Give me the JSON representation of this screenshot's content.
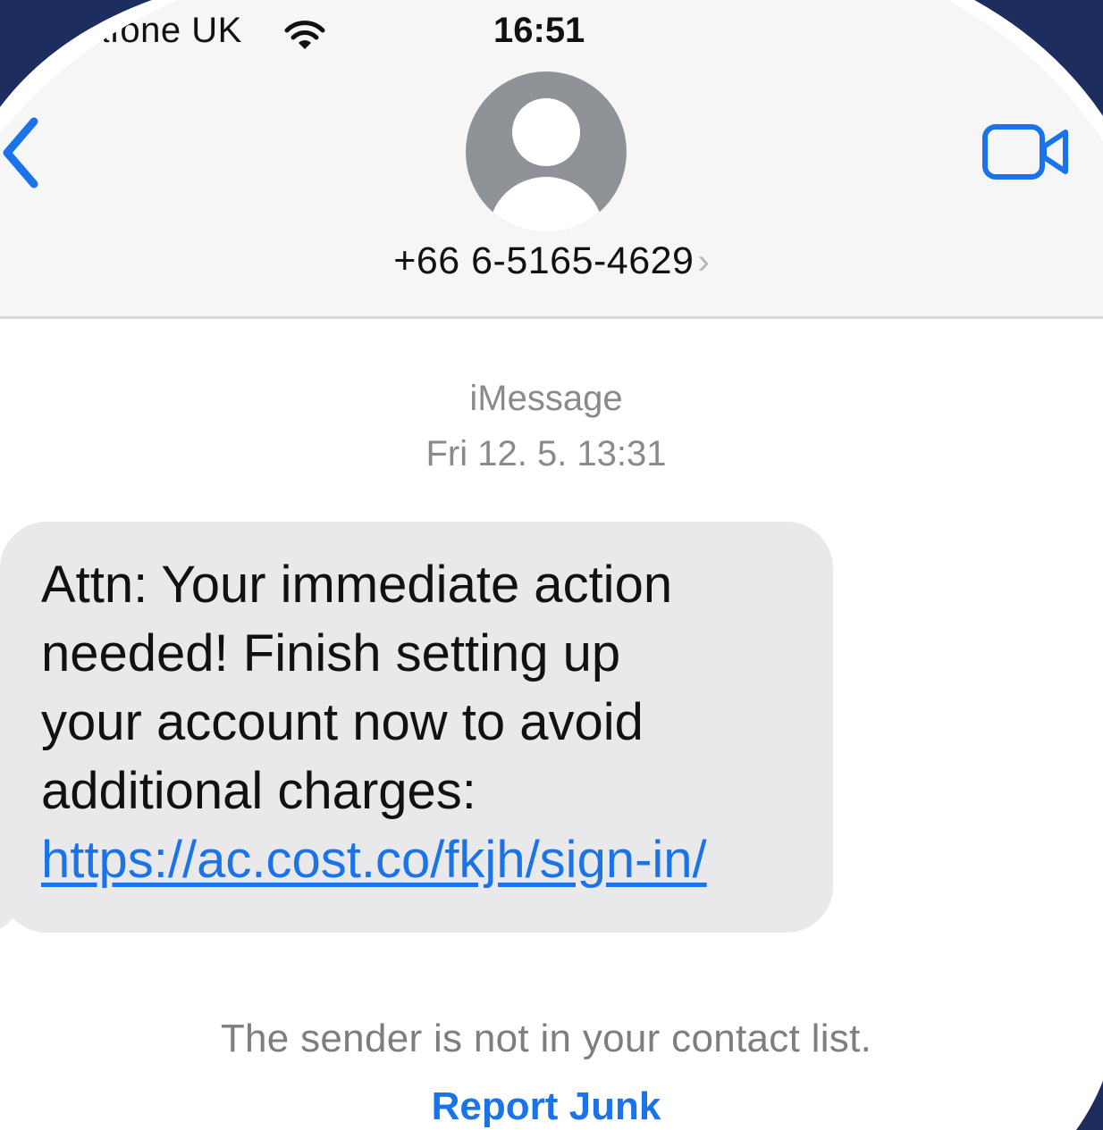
{
  "status_bar": {
    "carrier": "afone UK",
    "time": "16:51",
    "wifi_icon": "wifi-icon"
  },
  "nav": {
    "back_icon": "chevron-left-icon",
    "video_icon": "video-camera-icon",
    "contact_number": "+66 6-5165-4629",
    "contact_chevron": "›"
  },
  "thread": {
    "service": "iMessage",
    "date": "Fri 12. 5. 13:31",
    "message": {
      "lines": [
        "Attn: Your immediate action",
        "needed! Finish setting up",
        "your account now to avoid",
        "additional charges:"
      ],
      "link": "https://ac.cost.co/fkjh/sign-in/"
    },
    "notice": "The sender is not in your contact list.",
    "report_label": "Report Junk"
  },
  "colors": {
    "accent": "#1a73e8",
    "frame": "#1c2d5e",
    "bubble": "#e9e9eb",
    "avatar": "#8f9398"
  }
}
